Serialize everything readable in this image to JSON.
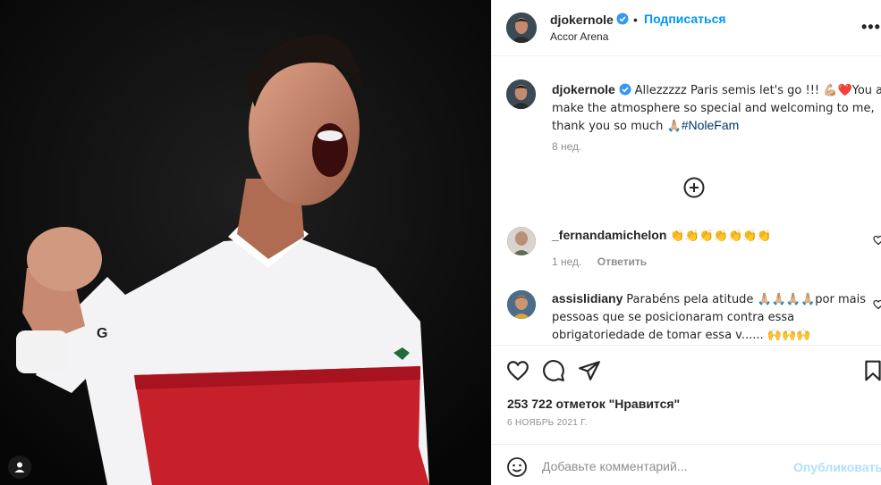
{
  "post": {
    "author": "djokernole",
    "follow_label": "Подписаться",
    "dot": "•",
    "location": "Accor Arena",
    "more_label": "•••"
  },
  "caption": {
    "username": "djokernole",
    "text": "Allezzzzz Paris semis let's go !!! 💪🏼❤️You all make the atmosphere so special and welcoming to me, thank you so much 🙏🏼",
    "hashtag": "#NoleFam",
    "time": "8 нед."
  },
  "comments": [
    {
      "username": "_fernandamichelon",
      "text": "👏👏👏👏👏👏👏",
      "time": "1 нед.",
      "reply_label": "Ответить"
    },
    {
      "username": "assislidiany",
      "text": "Parabéns pela atitude 🙏🏼🙏🏼🙏🏼🙏🏼por mais pessoas que se posicionaram contra essa obrigatoriedade de tomar essa v...... 🙌🙌🙌"
    }
  ],
  "actions": {
    "likes": "253 722 отметок \"Нравится\"",
    "date": "6 НОЯБРЬ 2021 Г."
  },
  "add_comment": {
    "placeholder": "Добавьте комментарий...",
    "publish_label": "Опубликовать"
  },
  "colors": {
    "accent": "#0095f6",
    "verified": "#3897f0",
    "muted": "#8e8e8e",
    "publish_disabled": "#b2dffc"
  },
  "icons": [
    "user-tag-icon",
    "verified-badge-icon",
    "more-options-icon",
    "add-circle-icon",
    "heart-icon",
    "comment-icon",
    "share-icon",
    "bookmark-icon",
    "emoji-icon"
  ]
}
